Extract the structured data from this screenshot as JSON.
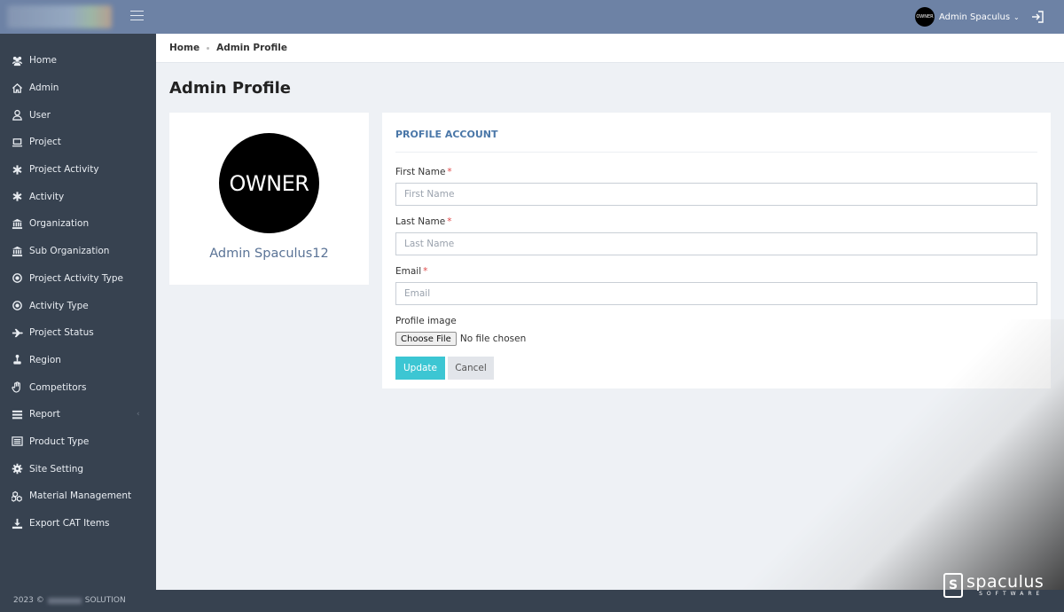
{
  "header": {
    "user_avatar_text": "OWNER",
    "user_name": "Admin Spaculus",
    "caret": "⌄"
  },
  "sidebar": {
    "items": [
      {
        "label": "Home",
        "icon": "users-icon"
      },
      {
        "label": "Admin",
        "icon": "house-icon"
      },
      {
        "label": "User",
        "icon": "person-icon"
      },
      {
        "label": "Project",
        "icon": "laptop-icon"
      },
      {
        "label": "Project Activity",
        "icon": "asterisk-icon"
      },
      {
        "label": "Activity",
        "icon": "asterisk-icon"
      },
      {
        "label": "Organization",
        "icon": "bank-icon"
      },
      {
        "label": "Sub Organization",
        "icon": "bank-icon"
      },
      {
        "label": "Project Activity Type",
        "icon": "target-icon"
      },
      {
        "label": "Activity Type",
        "icon": "target-icon"
      },
      {
        "label": "Project Status",
        "icon": "plane-icon"
      },
      {
        "label": "Region",
        "icon": "joystick-icon"
      },
      {
        "label": "Competitors",
        "icon": "hand-icon"
      },
      {
        "label": "Report",
        "icon": "list-icon",
        "chevron": "‹"
      },
      {
        "label": "Product Type",
        "icon": "list-alt-icon"
      },
      {
        "label": "Site Setting",
        "icon": "gear-icon"
      },
      {
        "label": "Material Management",
        "icon": "cubes-icon"
      },
      {
        "label": "Export CAT Items",
        "icon": "download-icon"
      }
    ]
  },
  "footer": {
    "year": "2023 ©",
    "company": "SOLUTION"
  },
  "breadcrumb": {
    "home": "Home",
    "current": "Admin Profile"
  },
  "page": {
    "title": "Admin Profile"
  },
  "profile": {
    "avatar_text": "OWNER",
    "name": "Admin Spaculus12"
  },
  "form": {
    "heading": "PROFILE ACCOUNT",
    "first_name_label": "First Name",
    "first_name_placeholder": "First Name",
    "first_name_value": "",
    "last_name_label": "Last Name",
    "last_name_placeholder": "Last Name",
    "last_name_value": "",
    "email_label": "Email",
    "email_placeholder": "Email",
    "email_value": "",
    "required_mark": "*",
    "profile_image_label": "Profile image",
    "choose_file_label": "Choose File",
    "file_status": "No file chosen",
    "update_label": "Update",
    "cancel_label": "Cancel"
  },
  "watermark": {
    "mark": "S",
    "word": "spaculus",
    "sub": "SOFTWARE"
  },
  "colors": {
    "topbar": "#6d82a5",
    "sidebar": "#374250",
    "accent_heading": "#4a77a8",
    "update_button": "#3cc6d3",
    "required": "#e04a4a"
  }
}
